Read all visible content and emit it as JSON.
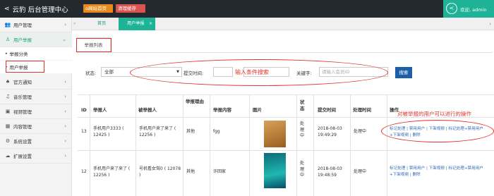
{
  "header": {
    "brand": "云豹 后台管理中心",
    "home_btn": "网站首页",
    "clear_cache_btn": "清理缓存",
    "welcome": "欢迎, admin"
  },
  "sidebar": {
    "items": [
      {
        "label": "用户管理",
        "icon": "users-icon"
      },
      {
        "label": "用户举报",
        "icon": "report-user-icon"
      },
      {
        "label": "官方通知",
        "icon": "bell-icon"
      },
      {
        "label": "音乐管理",
        "icon": "music-icon"
      },
      {
        "label": "视频管理",
        "icon": "video-icon"
      },
      {
        "label": "内容管理",
        "icon": "grid-icon"
      },
      {
        "label": "系统设置",
        "icon": "gear-icon"
      },
      {
        "label": "扩展设置",
        "icon": "cloud-icon"
      }
    ],
    "sub_items": [
      "举报分类",
      "用户举报"
    ]
  },
  "tabs": {
    "home": "首页",
    "report": "用户举报"
  },
  "sub_tab": "举报列表",
  "filter": {
    "status_label": "状态:",
    "status_value": "全部",
    "submit_time_label": "提交时间:",
    "keyword_label": "关键字:",
    "keyword_placeholder": "请输入会员ID",
    "search_btn": "搜索",
    "annotation": "输入条件搜索"
  },
  "annotation_ops": "对被举报的用户可以进行的操作",
  "table": {
    "headers": [
      "ID",
      "举报人",
      "被举报人",
      "举报理由",
      "举报内容",
      "图片",
      "状态",
      "提交时间",
      "处理时间",
      "操作"
    ],
    "rows": [
      {
        "id": "13",
        "reporter": "手机用户3333 ( 12425 )",
        "reported": "手机用户来了来了 ( 12256 )",
        "reason": "其他",
        "content": "fgg",
        "status": "处理中",
        "submit_time": "2018-08-03 19:49:29",
        "handle_time": "处理中",
        "ops": "标记处理 | 禁用用户 | 下架视频 | 标记处理+禁用用户+下架视频 | 删除"
      },
      {
        "id": "12",
        "reporter": "手机用户来了来了 ( 12256 )",
        "reported": "号机看女驾0 ( 12078 )",
        "reason": "其他",
        "content": "诈回家",
        "status": "处理中",
        "submit_time": "2018-08-03 19:48:59",
        "handle_time": "处理中",
        "ops": "标记处理 | 禁用用户 | 下架视频 | 标记处理+禁用用户+下架视频 | 删除"
      }
    ]
  }
}
